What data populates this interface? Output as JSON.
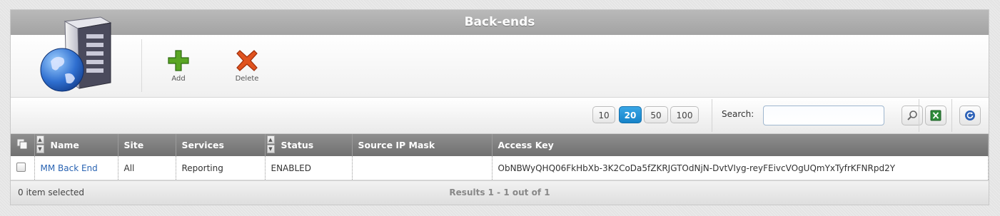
{
  "window": {
    "title": "Back-ends"
  },
  "toolbar": {
    "logo_icon": "server-globe-icon",
    "buttons": [
      {
        "label": "Add",
        "icon": "plus-icon",
        "color": "#4a9a1f"
      },
      {
        "label": "Delete",
        "icon": "x-icon",
        "color": "#d9441c"
      }
    ]
  },
  "pager": {
    "sizes": [
      "10",
      "20",
      "50",
      "100"
    ],
    "selected": "20",
    "accent": "#1d8fd6"
  },
  "search": {
    "label": "Search:",
    "value": "",
    "placeholder": ""
  },
  "actions": {
    "search_icon": "magnifier-icon",
    "export_icon": "excel-icon",
    "refresh_icon": "refresh-icon"
  },
  "table": {
    "columns": [
      "Name",
      "Site",
      "Services",
      "Status",
      "Source IP Mask",
      "Access Key"
    ],
    "rows": [
      {
        "name": "MM Back End",
        "site": "All",
        "services": "Reporting",
        "status": "ENABLED",
        "source_ip_mask": "",
        "access_key": "ObNBWyQHQ06FkHbXb-3K2CoDa5fZKRJGTOdNjN-DvtVIyg-reyFEivcVOgUQmYxTyfrKFNRpd2Y"
      }
    ]
  },
  "footer": {
    "selected_text": "0 item selected",
    "results_text": "Results 1 - 1 out of 1"
  }
}
